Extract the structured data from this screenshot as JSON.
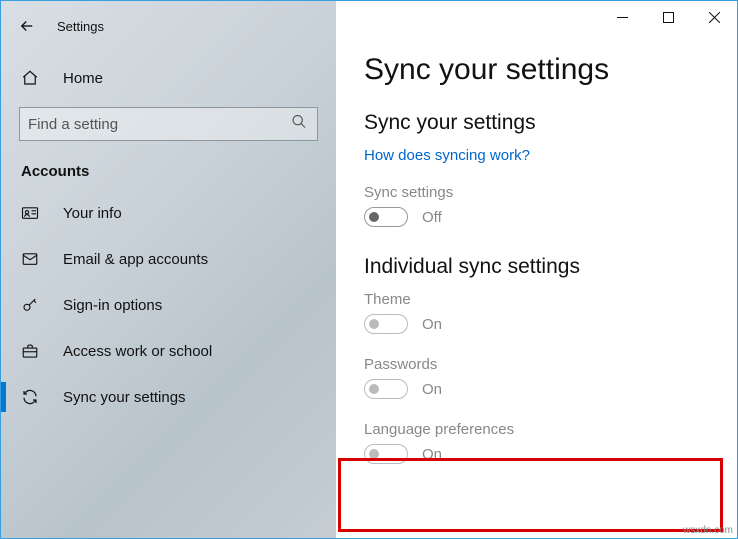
{
  "window": {
    "title": "Settings"
  },
  "sidebar": {
    "home_label": "Home",
    "search_placeholder": "Find a setting",
    "section_title": "Accounts",
    "items": [
      {
        "label": "Your info"
      },
      {
        "label": "Email & app accounts"
      },
      {
        "label": "Sign-in options"
      },
      {
        "label": "Access work or school"
      },
      {
        "label": "Sync your settings"
      }
    ]
  },
  "content": {
    "page_title": "Sync your settings",
    "section1_title": "Sync your settings",
    "help_link": "How does syncing work?",
    "sync_settings": {
      "label": "Sync settings",
      "state": "Off"
    },
    "section2_title": "Individual sync settings",
    "theme": {
      "label": "Theme",
      "state": "On"
    },
    "passwords": {
      "label": "Passwords",
      "state": "On"
    },
    "language": {
      "label": "Language preferences",
      "state": "On"
    }
  },
  "watermark": "wsxdn.com"
}
